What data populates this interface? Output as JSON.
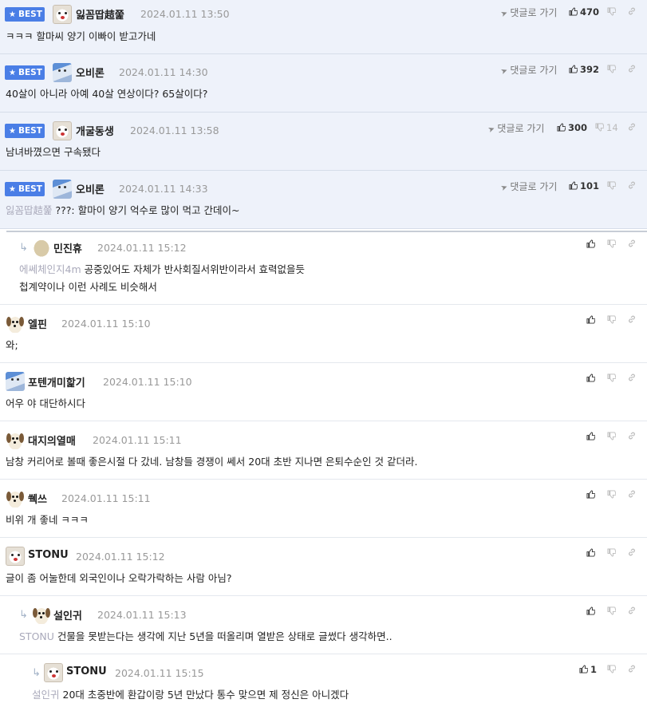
{
  "labels": {
    "best": "BEST",
    "goto": "댓글로 가기"
  },
  "colors": {
    "best_bg": "#4a7ee6",
    "best_row": "#eef2fa"
  },
  "comments": [
    {
      "best": true,
      "nick": "잃꼼땁趌쭕",
      "time": "2024.01.11 13:50",
      "body": "ㅋㅋㅋ 할마씨 양기 이빠이 받고가네",
      "up": "470",
      "down": "",
      "avatar": "dog"
    },
    {
      "best": true,
      "nick": "오비론",
      "time": "2024.01.11 14:30",
      "body": "40살이 아니라 아예 40살 연상이다? 65살이다?",
      "up": "392",
      "down": "",
      "avatar": "ghost"
    },
    {
      "best": true,
      "nick": "개굴동생",
      "time": "2024.01.11 13:58",
      "body": "남녀바꼈으면 구속됐다",
      "up": "300",
      "down": "14",
      "avatar": "dog"
    },
    {
      "best": true,
      "nick": "오비론",
      "time": "2024.01.11 14:33",
      "mention": "잃꼼땁趌쭕",
      "body": "???: 할마이 양기 억수로 많이 먹고 간데이~",
      "up": "101",
      "down": "",
      "avatar": "ghost"
    },
    {
      "reply": true,
      "nick": "민진휴",
      "time": "2024.01.11 15:12",
      "mention": "에쎄체인지4m",
      "body": "공중있어도 자체가 반사회질서위반이라서 효력없을듯",
      "body2": "첩계약이나 이런 사례도 비슷해서",
      "up": "",
      "down": "",
      "avatar": "potato"
    },
    {
      "nick": "엘핀",
      "time": "2024.01.11 15:10",
      "body": "와;",
      "up": "",
      "down": "",
      "avatar": "pup"
    },
    {
      "nick": "포텐개미핥기",
      "time": "2024.01.11 15:10",
      "body": "어우 야 대단하시다",
      "up": "",
      "down": "",
      "avatar": "ghost"
    },
    {
      "nick": "대지의열매",
      "time": "2024.01.11 15:11",
      "body": "남창 커리어로 볼때 좋은시절 다 갔네. 남창들 경쟁이 쎄서 20대 초반 지나면 은퇴수순인 것 같더라.",
      "up": "",
      "down": "",
      "avatar": "pup"
    },
    {
      "nick": "쒝쓰",
      "time": "2024.01.11 15:11",
      "body": "비위 개 좋네 ㅋㅋㅋ",
      "up": "",
      "down": "",
      "avatar": "pup"
    },
    {
      "nick": "STONU",
      "time": "2024.01.11 15:12",
      "body": "글이 좀 어눌한데 외국인이나 오락가락하는 사람 아님?",
      "up": "",
      "down": "",
      "avatar": "dog"
    },
    {
      "reply": true,
      "nick": "설인귀",
      "time": "2024.01.11 15:13",
      "mention": "STONU",
      "body": "건물을 못받는다는 생각에 지난 5년을 떠올리며 열받은 상태로 글썼다 생각하면..",
      "up": "",
      "down": "",
      "avatar": "pup"
    },
    {
      "reply": true,
      "nick": "STONU",
      "time": "2024.01.11 15:15",
      "mention": "설인귀",
      "body": "20대 초중반에 환갑이랑 5년 만났다 통수 맞으면 제 정신은 아니겠다",
      "up": "1",
      "down": "",
      "avatar": "dog"
    }
  ]
}
